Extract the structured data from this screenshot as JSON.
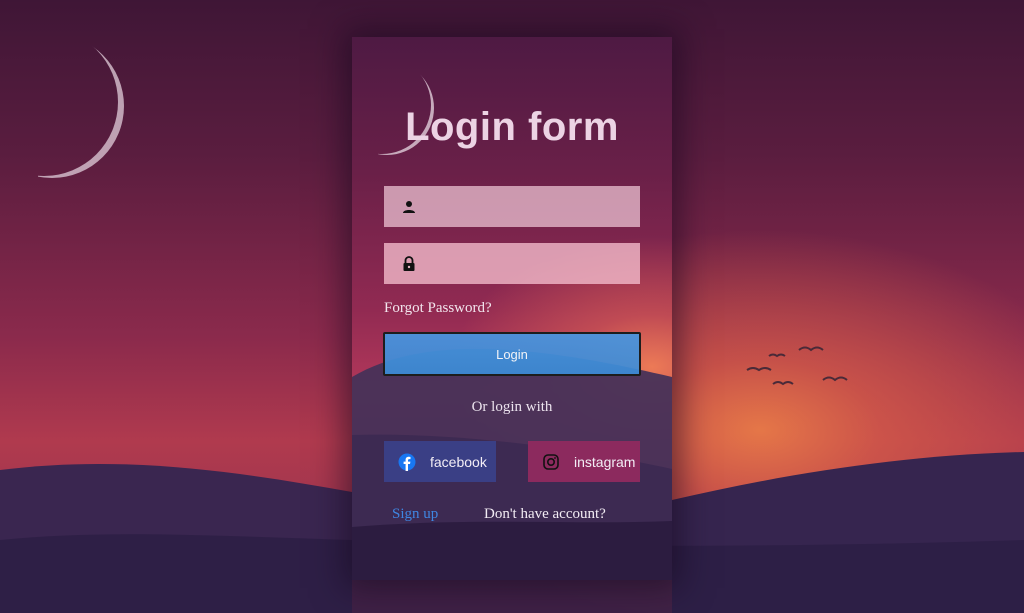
{
  "form": {
    "title": "Login form",
    "username": {
      "value": "",
      "icon": "person-icon"
    },
    "password": {
      "value": "",
      "icon": "lock-icon"
    },
    "forgot_label": "Forgot Password?",
    "login_label": "Login",
    "or_label": "Or login with",
    "social": {
      "facebook_label": "facebook",
      "instagram_label": "instagram"
    },
    "signup_label": "Sign up",
    "no_account_label": "Don't have account?"
  },
  "colors": {
    "accent_blue": "#3f86e2",
    "facebook": "#3a3f85",
    "instagram": "#8c2a5e"
  }
}
